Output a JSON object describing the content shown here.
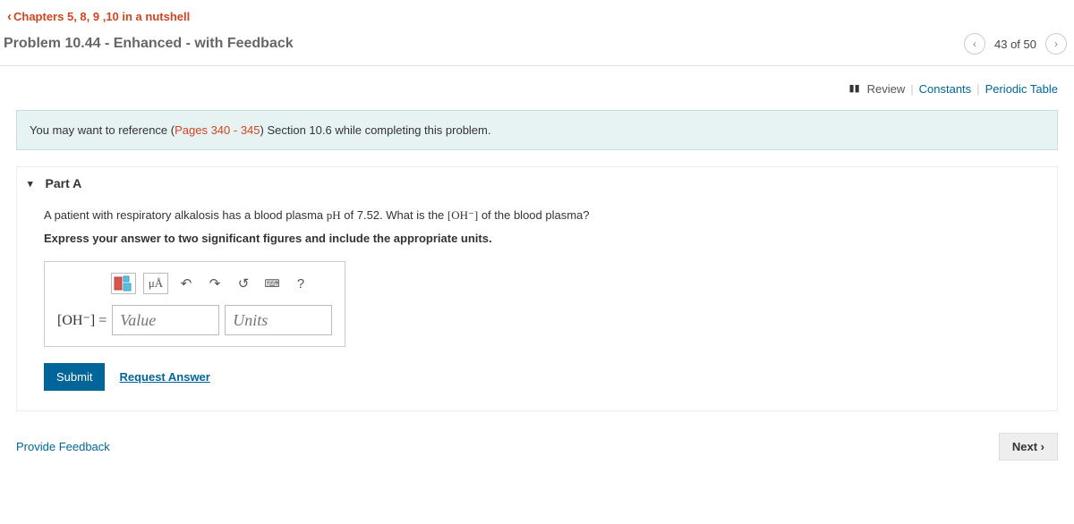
{
  "breadcrumb": "Chapters 5, 8, 9 ,10 in a nutshell",
  "title": "Problem 10.44 - Enhanced - with Feedback",
  "nav": {
    "count": "43 of 50"
  },
  "links": {
    "review": "Review",
    "constants": "Constants",
    "periodic": "Periodic Table"
  },
  "info": {
    "pre": "You may want to reference (",
    "ref": "Pages 340 - 345",
    "post": ") Section 10.6 while completing this problem."
  },
  "part": {
    "label": "Part A",
    "q1": "A patient with respiratory alkalosis has a blood plasma ",
    "q_ph": "pH",
    "q2": " of 7.52. What is the ",
    "q_oh": "[OH⁻]",
    "q3": " of the blood plasma?",
    "instruction": "Express your answer to two significant figures and include the appropriate units."
  },
  "toolbar": {
    "mu": "μÅ",
    "help": "?"
  },
  "input": {
    "lhs": "[OH⁻] =",
    "value_placeholder": "Value",
    "units_placeholder": "Units"
  },
  "actions": {
    "submit": "Submit",
    "request": "Request Answer"
  },
  "footer": {
    "feedback": "Provide Feedback",
    "next": "Next"
  }
}
